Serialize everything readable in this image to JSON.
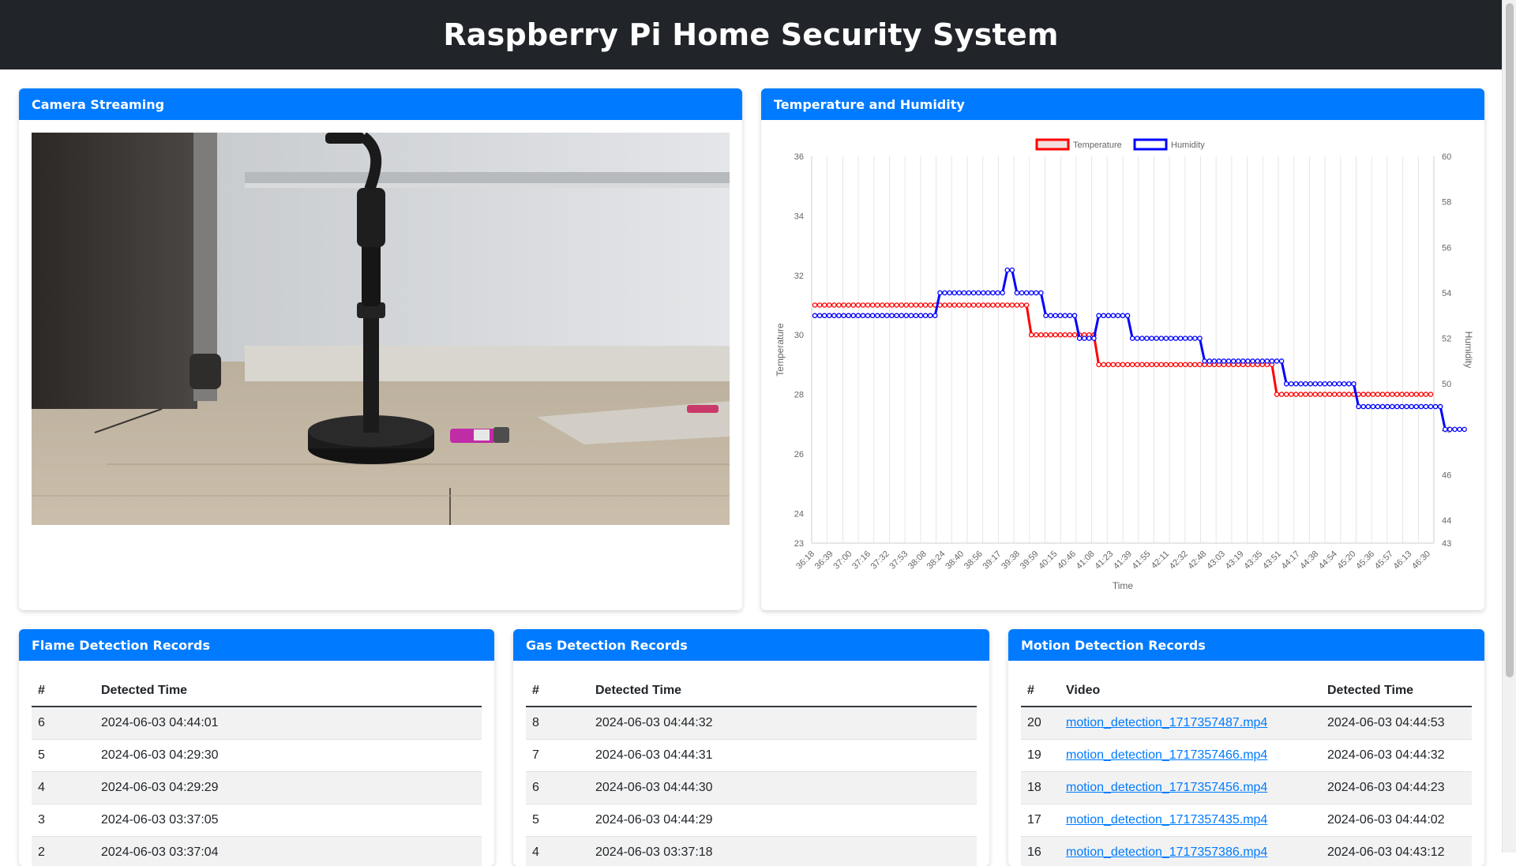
{
  "header": {
    "title": "Raspberry Pi Home Security System"
  },
  "camera": {
    "title": "Camera Streaming"
  },
  "chart_card": {
    "title": "Temperature and Humidity"
  },
  "chart_data": {
    "type": "line",
    "title": "",
    "xlabel": "Time",
    "ylabel_left": "Temperature",
    "ylabel_right": "Humidity",
    "y_left_range": [
      23,
      36
    ],
    "y_left_ticks": [
      "36",
      "34",
      "32",
      "30",
      "28",
      "26",
      "24",
      "23"
    ],
    "y_right_range": [
      43,
      60
    ],
    "y_right_ticks": [
      "60",
      "58",
      "56",
      "54",
      "52",
      "50",
      "48",
      "46",
      "44",
      "43"
    ],
    "x_tick_labels": [
      "36:18",
      "36:39",
      "37:00",
      "37:16",
      "37:32",
      "37:53",
      "38:08",
      "38:24",
      "38:40",
      "38:56",
      "39:17",
      "39:38",
      "39:59",
      "40:15",
      "40:46",
      "41:08",
      "41:23",
      "41:39",
      "41:55",
      "42:11",
      "42:32",
      "42:48",
      "43:03",
      "43:19",
      "43:35",
      "43:51",
      "44:17",
      "44:38",
      "44:54",
      "45:20",
      "45:36",
      "45:57",
      "46:13",
      "46:30"
    ],
    "legend_position": "top-center",
    "grid": "vertical",
    "series": [
      {
        "name": "Temperature",
        "axis": "left",
        "color": "#ff0000",
        "values": [
          31,
          31,
          31,
          31,
          31,
          31,
          31,
          31,
          31,
          31,
          31,
          31,
          31,
          31,
          31,
          31,
          31,
          31,
          31,
          31,
          31,
          31,
          31,
          31,
          31,
          31,
          31,
          31,
          31,
          31,
          31,
          31,
          31,
          31,
          31,
          31,
          31,
          31,
          31,
          31,
          31,
          31,
          31,
          31,
          31,
          30,
          30,
          30,
          30,
          30,
          30,
          30,
          30,
          30,
          30,
          30,
          30,
          30,
          30,
          29,
          29,
          29,
          29,
          29,
          29,
          29,
          29,
          29,
          29,
          29,
          29,
          29,
          29,
          29,
          29,
          29,
          29,
          29,
          29,
          29,
          29,
          29,
          29,
          29,
          29,
          29,
          29,
          29,
          29,
          29,
          29,
          29,
          29,
          29,
          29,
          29,
          28,
          28,
          28,
          28,
          28,
          28,
          28,
          28,
          28,
          28,
          28,
          28,
          28,
          28,
          28,
          28,
          28,
          28,
          28,
          28,
          28,
          28,
          28,
          28,
          28,
          28,
          28,
          28,
          28,
          28,
          28,
          28,
          28
        ]
      },
      {
        "name": "Humidity",
        "axis": "right",
        "color": "#0000ff",
        "values": [
          53,
          53,
          53,
          53,
          53,
          53,
          53,
          53,
          53,
          53,
          53,
          53,
          53,
          53,
          53,
          53,
          53,
          53,
          53,
          53,
          53,
          53,
          53,
          53,
          53,
          53,
          54,
          54,
          54,
          54,
          54,
          54,
          54,
          54,
          54,
          54,
          54,
          54,
          54,
          54,
          55,
          55,
          54,
          54,
          54,
          54,
          54,
          54,
          53,
          53,
          53,
          53,
          53,
          53,
          53,
          52,
          52,
          52,
          52,
          53,
          53,
          53,
          53,
          53,
          53,
          53,
          52,
          52,
          52,
          52,
          52,
          52,
          52,
          52,
          52,
          52,
          52,
          52,
          52,
          52,
          52,
          51,
          51,
          51,
          51,
          51,
          51,
          51,
          51,
          51,
          51,
          51,
          51,
          51,
          51,
          51,
          51,
          51,
          50,
          50,
          50,
          50,
          50,
          50,
          50,
          50,
          50,
          50,
          50,
          50,
          50,
          50,
          50,
          49,
          49,
          49,
          49,
          49,
          49,
          49,
          49,
          49,
          49,
          49,
          49,
          49,
          49,
          49,
          49,
          49,
          49,
          48,
          48,
          48,
          48,
          48
        ]
      }
    ]
  },
  "flame": {
    "title": "Flame Detection Records",
    "col_num": "#",
    "col_time": "Detected Time",
    "rows": [
      {
        "num": "6",
        "time": "2024-06-03 04:44:01"
      },
      {
        "num": "5",
        "time": "2024-06-03 04:29:30"
      },
      {
        "num": "4",
        "time": "2024-06-03 04:29:29"
      },
      {
        "num": "3",
        "time": "2024-06-03 03:37:05"
      },
      {
        "num": "2",
        "time": "2024-06-03 03:37:04"
      }
    ]
  },
  "gas": {
    "title": "Gas Detection Records",
    "col_num": "#",
    "col_time": "Detected Time",
    "rows": [
      {
        "num": "8",
        "time": "2024-06-03 04:44:32"
      },
      {
        "num": "7",
        "time": "2024-06-03 04:44:31"
      },
      {
        "num": "6",
        "time": "2024-06-03 04:44:30"
      },
      {
        "num": "5",
        "time": "2024-06-03 04:44:29"
      },
      {
        "num": "4",
        "time": "2024-06-03 03:37:18"
      }
    ]
  },
  "motion": {
    "title": "Motion Detection Records",
    "col_num": "#",
    "col_video": "Video",
    "col_time": "Detected Time",
    "rows": [
      {
        "num": "20",
        "video": "motion_detection_1717357487.mp4",
        "time": "2024-06-03 04:44:53"
      },
      {
        "num": "19",
        "video": "motion_detection_1717357466.mp4",
        "time": "2024-06-03 04:44:32"
      },
      {
        "num": "18",
        "video": "motion_detection_1717357456.mp4",
        "time": "2024-06-03 04:44:23"
      },
      {
        "num": "17",
        "video": "motion_detection_1717357435.mp4",
        "time": "2024-06-03 04:44:02"
      },
      {
        "num": "16",
        "video": "motion_detection_1717357386.mp4",
        "time": "2024-06-03 04:43:12"
      }
    ]
  }
}
